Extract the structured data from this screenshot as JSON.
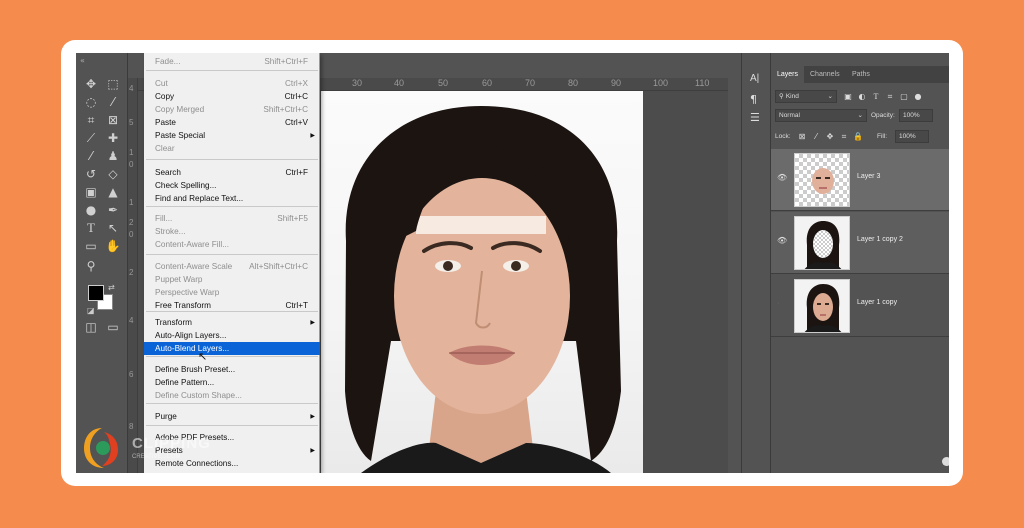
{
  "colors": {
    "background": "#f58b4c",
    "menu_highlight": "#0a64d8"
  },
  "ruler": {
    "top": [
      "30",
      "40",
      "50",
      "60",
      "70",
      "80",
      "90",
      "100",
      "110"
    ],
    "left": [
      "4",
      "5",
      "1",
      "0",
      "1",
      "2",
      "0",
      "2",
      "4",
      "6",
      "8"
    ]
  },
  "edit_menu": {
    "items": [
      {
        "label": "Fade...",
        "shortcut": "Shift+Ctrl+F",
        "state": "disabled"
      },
      {
        "label": "Cut",
        "shortcut": "Ctrl+X",
        "state": "disabled"
      },
      {
        "label": "Copy",
        "shortcut": "Ctrl+C",
        "state": "enabled"
      },
      {
        "label": "Copy Merged",
        "shortcut": "Shift+Ctrl+C",
        "state": "disabled"
      },
      {
        "label": "Paste",
        "shortcut": "Ctrl+V",
        "state": "enabled"
      },
      {
        "label": "Paste Special",
        "shortcut": "",
        "state": "enabled",
        "submenu": true
      },
      {
        "label": "Clear",
        "shortcut": "",
        "state": "disabled"
      },
      {
        "label": "Search",
        "shortcut": "Ctrl+F",
        "state": "enabled"
      },
      {
        "label": "Check Spelling...",
        "shortcut": "",
        "state": "enabled"
      },
      {
        "label": "Find and Replace Text...",
        "shortcut": "",
        "state": "enabled"
      },
      {
        "label": "Fill...",
        "shortcut": "Shift+F5",
        "state": "disabled"
      },
      {
        "label": "Stroke...",
        "shortcut": "",
        "state": "disabled"
      },
      {
        "label": "Content-Aware Fill...",
        "shortcut": "",
        "state": "disabled"
      },
      {
        "label": "Content-Aware Scale",
        "shortcut": "Alt+Shift+Ctrl+C",
        "state": "disabled"
      },
      {
        "label": "Puppet Warp",
        "shortcut": "",
        "state": "disabled"
      },
      {
        "label": "Perspective Warp",
        "shortcut": "",
        "state": "disabled"
      },
      {
        "label": "Free Transform",
        "shortcut": "Ctrl+T",
        "state": "enabled"
      },
      {
        "label": "Transform",
        "shortcut": "",
        "state": "enabled",
        "submenu": true
      },
      {
        "label": "Auto-Align Layers...",
        "shortcut": "",
        "state": "enabled"
      },
      {
        "label": "Auto-Blend Layers...",
        "shortcut": "",
        "state": "highlighted"
      },
      {
        "label": "Define Brush Preset...",
        "shortcut": "",
        "state": "enabled"
      },
      {
        "label": "Define Pattern...",
        "shortcut": "",
        "state": "enabled"
      },
      {
        "label": "Define Custom Shape...",
        "shortcut": "",
        "state": "disabled"
      },
      {
        "label": "Purge",
        "shortcut": "",
        "state": "enabled",
        "submenu": true
      },
      {
        "label": "Adobe PDF Presets...",
        "shortcut": "",
        "state": "enabled"
      },
      {
        "label": "Presets",
        "shortcut": "",
        "state": "enabled",
        "submenu": true
      },
      {
        "label": "Remote Connections...",
        "shortcut": "",
        "state": "enabled"
      }
    ]
  },
  "layers_panel": {
    "tabs": [
      "Layers",
      "Channels",
      "Paths"
    ],
    "active_tab": "Layers",
    "kind_filter": "Kind",
    "blend_mode": "Normal",
    "opacity_label": "Opacity:",
    "opacity_value": "100%",
    "lock_label": "Lock:",
    "fill_label": "Fill:",
    "fill_value": "100%",
    "layers": [
      {
        "name": "Layer 3",
        "visible": true,
        "thumbnail": "face-features-on-transparency"
      },
      {
        "name": "Layer 1 copy 2",
        "visible": true,
        "thumbnail": "portrait-with-masked-face"
      },
      {
        "name": "Layer 1 copy",
        "visible": false,
        "thumbnail": "portrait"
      }
    ]
  },
  "watermark": {
    "brand": "CLIPPING",
    "sub": "CREATIVE...COM"
  },
  "icons": {
    "tools": [
      "move-icon",
      "marquee-icon",
      "lasso-icon",
      "magic-wand-icon",
      "crop-icon",
      "frame-icon",
      "eyedropper-icon",
      "healing-icon",
      "brush-icon",
      "stamp-icon",
      "history-brush-icon",
      "eraser-icon",
      "gradient-icon",
      "blur-icon",
      "dodge-icon",
      "pen-icon",
      "type-icon",
      "path-select-icon",
      "shape-icon",
      "hand-icon",
      "zoom-icon"
    ],
    "right_strip": [
      "character-icon",
      "paragraph-icon",
      "properties-icon"
    ]
  }
}
